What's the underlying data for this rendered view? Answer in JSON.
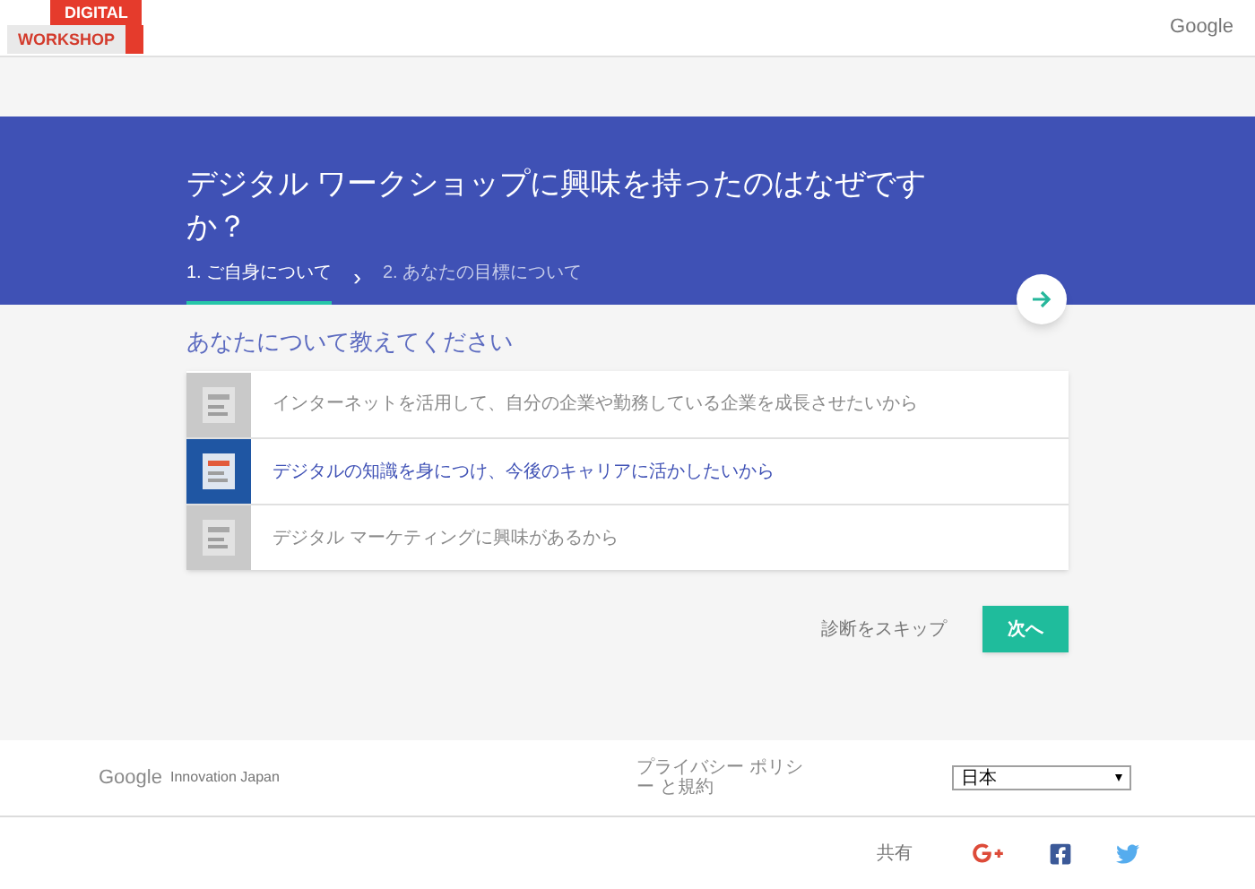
{
  "header": {
    "logo": {
      "line_1": "DIGITAL",
      "line_2": "WORKSHOP"
    },
    "brand": "Google"
  },
  "hero": {
    "title": "デジタル ワークショップに興味を持ったのはなぜですか？",
    "steps": [
      {
        "label": "1. ご自身について",
        "selected": true
      },
      {
        "label": "2. あなたの目標について",
        "selected": false
      }
    ],
    "step_separator": "›"
  },
  "question": "あなたについて教えてください",
  "options": [
    {
      "label": "インターネットを活用して、自分の企業や勤務している企業を成長させたいから",
      "selected": false
    },
    {
      "label": "デジタルの知識を身につけ、今後のキャリアに活かしたいから",
      "selected": true
    },
    {
      "label": "デジタル マーケティングに興味があるから",
      "selected": false
    }
  ],
  "actions": {
    "skip": "診断をスキップ",
    "next": "次へ"
  },
  "footer": {
    "brand": "Google",
    "site": "Innovation Japan",
    "privacy": "プライバシー ポリシー と規約",
    "region": "日本",
    "share": "共有"
  }
}
